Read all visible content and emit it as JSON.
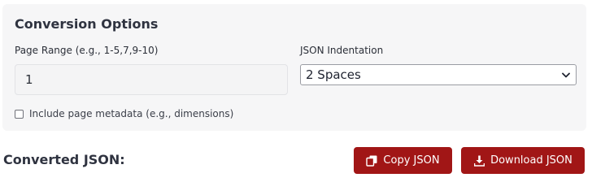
{
  "options": {
    "title": "Conversion Options",
    "page_range": {
      "label": "Page Range (e.g., 1-5,7,9-10)",
      "value": "1"
    },
    "indentation": {
      "label": "JSON Indentation",
      "selected": "2 Spaces"
    },
    "metadata": {
      "label": "Include page metadata (e.g., dimensions)",
      "checked": false
    }
  },
  "output": {
    "title": "Converted JSON:",
    "copy_label": "Copy JSON",
    "download_label": "Download JSON",
    "copy_icon": "copy-icon",
    "download_icon": "download-icon"
  },
  "colors": {
    "button_bg": "#a11616",
    "panel_bg": "#f6f6f7",
    "text": "#2b2f38"
  }
}
